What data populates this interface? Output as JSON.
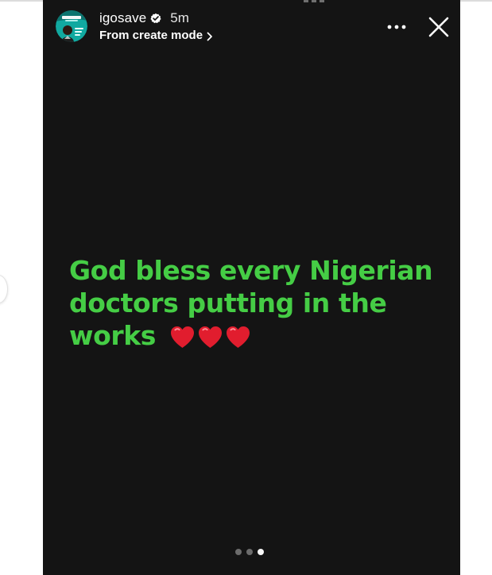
{
  "account": {
    "username": "igosave",
    "time_ago": "5m",
    "subtitle": "From create mode",
    "verified": true,
    "avatar_icon": "profile-avatar-icon"
  },
  "header": {
    "more_icon": "more-horizontal-icon",
    "close_icon": "close-icon"
  },
  "story": {
    "text": "God bless every Nigerian doctors putting in the works",
    "emojis": [
      "❤️",
      "❤️",
      "❤️"
    ],
    "text_color": "#45CD45",
    "background_color": "#141414"
  },
  "progress": {
    "count": 3,
    "current_index": 3
  }
}
